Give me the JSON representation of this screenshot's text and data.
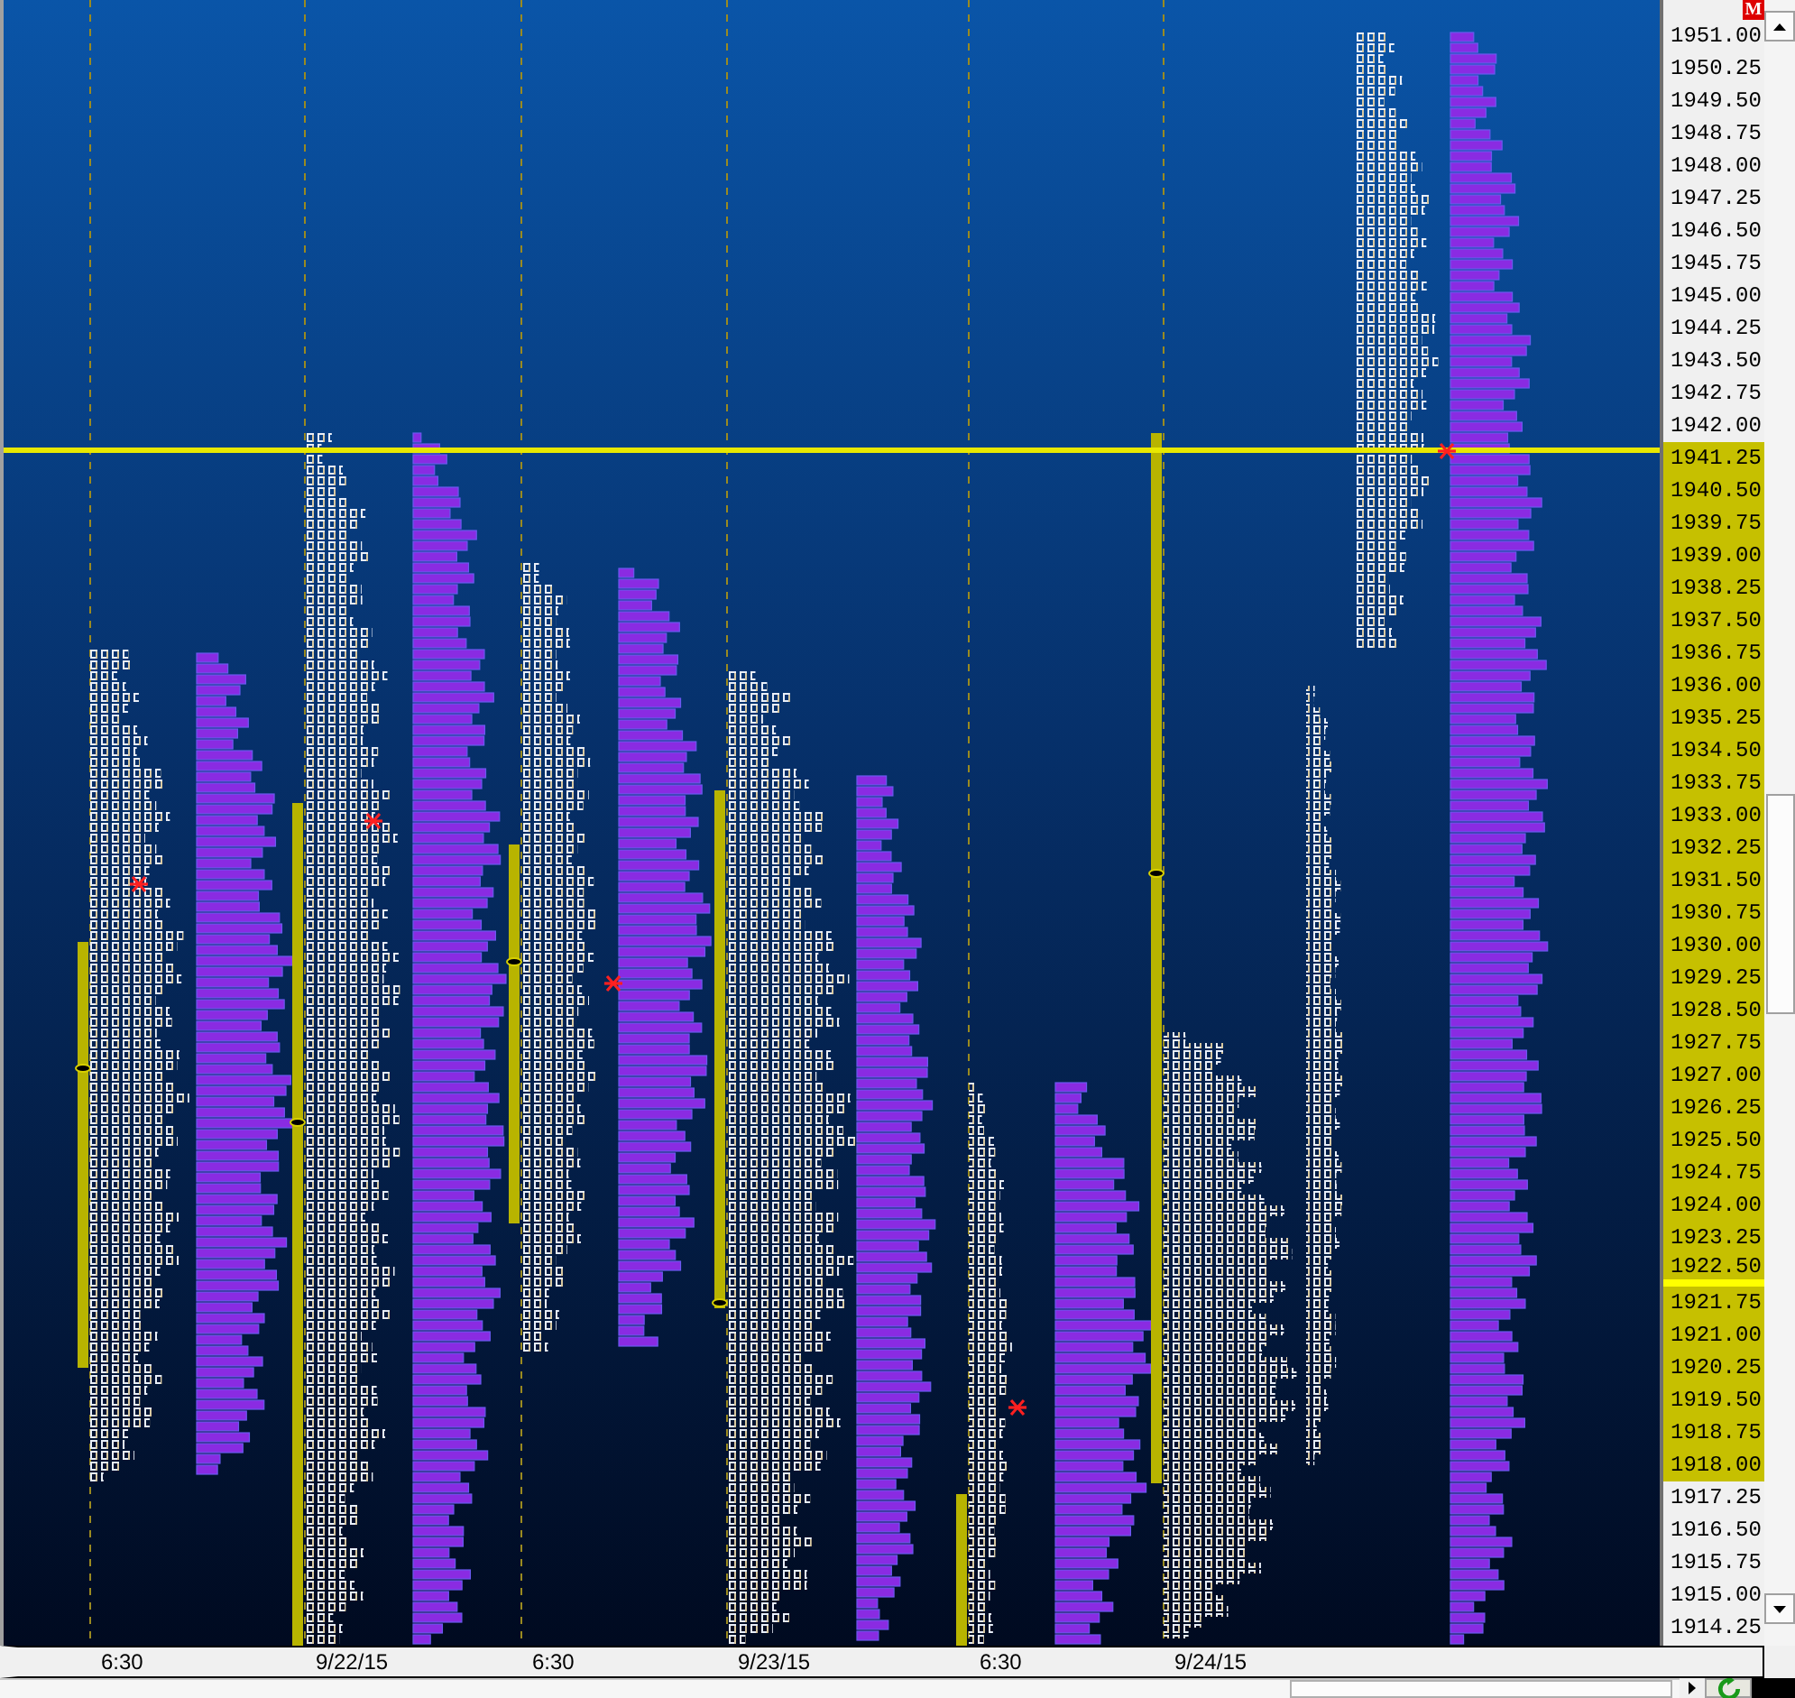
{
  "price_axis": {
    "badge": "M",
    "labels": [
      {
        "text": "1951.00",
        "highlighted": false,
        "marked": false
      },
      {
        "text": "1950.25",
        "highlighted": false,
        "marked": false
      },
      {
        "text": "1949.50",
        "highlighted": false,
        "marked": false
      },
      {
        "text": "1948.75",
        "highlighted": false,
        "marked": false
      },
      {
        "text": "1948.00",
        "highlighted": false,
        "marked": false
      },
      {
        "text": "1947.25",
        "highlighted": false,
        "marked": false
      },
      {
        "text": "1946.50",
        "highlighted": false,
        "marked": false
      },
      {
        "text": "1945.75",
        "highlighted": false,
        "marked": false
      },
      {
        "text": "1945.00",
        "highlighted": false,
        "marked": false
      },
      {
        "text": "1944.25",
        "highlighted": false,
        "marked": false
      },
      {
        "text": "1943.50",
        "highlighted": false,
        "marked": false
      },
      {
        "text": "1942.75",
        "highlighted": false,
        "marked": false
      },
      {
        "text": "1942.00",
        "highlighted": false,
        "marked": false
      },
      {
        "text": "1941.25",
        "highlighted": true,
        "marked": false
      },
      {
        "text": "1940.50",
        "highlighted": true,
        "marked": false
      },
      {
        "text": "1939.75",
        "highlighted": true,
        "marked": false
      },
      {
        "text": "1939.00",
        "highlighted": true,
        "marked": false
      },
      {
        "text": "1938.25",
        "highlighted": true,
        "marked": false
      },
      {
        "text": "1937.50",
        "highlighted": true,
        "marked": false
      },
      {
        "text": "1936.75",
        "highlighted": true,
        "marked": false
      },
      {
        "text": "1936.00",
        "highlighted": true,
        "marked": false
      },
      {
        "text": "1935.25",
        "highlighted": true,
        "marked": false
      },
      {
        "text": "1934.50",
        "highlighted": true,
        "marked": false
      },
      {
        "text": "1933.75",
        "highlighted": true,
        "marked": false
      },
      {
        "text": "1933.00",
        "highlighted": true,
        "marked": false
      },
      {
        "text": "1932.25",
        "highlighted": true,
        "marked": false
      },
      {
        "text": "1931.50",
        "highlighted": true,
        "marked": false
      },
      {
        "text": "1930.75",
        "highlighted": true,
        "marked": false
      },
      {
        "text": "1930.00",
        "highlighted": true,
        "marked": false
      },
      {
        "text": "1929.25",
        "highlighted": true,
        "marked": false
      },
      {
        "text": "1928.50",
        "highlighted": true,
        "marked": false
      },
      {
        "text": "1927.75",
        "highlighted": true,
        "marked": false
      },
      {
        "text": "1927.00",
        "highlighted": true,
        "marked": false
      },
      {
        "text": "1926.25",
        "highlighted": true,
        "marked": false
      },
      {
        "text": "1925.50",
        "highlighted": true,
        "marked": false
      },
      {
        "text": "1924.75",
        "highlighted": true,
        "marked": false
      },
      {
        "text": "1924.00",
        "highlighted": true,
        "marked": false
      },
      {
        "text": "1923.25",
        "highlighted": true,
        "marked": false
      },
      {
        "text": "1922.50",
        "highlighted": true,
        "marked": true
      },
      {
        "text": "1921.75",
        "highlighted": true,
        "marked": false
      },
      {
        "text": "1921.00",
        "highlighted": true,
        "marked": false
      },
      {
        "text": "1920.25",
        "highlighted": true,
        "marked": false
      },
      {
        "text": "1919.50",
        "highlighted": true,
        "marked": false
      },
      {
        "text": "1918.75",
        "highlighted": true,
        "marked": false
      },
      {
        "text": "1918.00",
        "highlighted": true,
        "marked": false
      },
      {
        "text": "1917.25",
        "highlighted": false,
        "marked": false
      },
      {
        "text": "1916.50",
        "highlighted": false,
        "marked": false
      },
      {
        "text": "1915.75",
        "highlighted": false,
        "marked": false
      },
      {
        "text": "1915.00",
        "highlighted": false,
        "marked": false
      },
      {
        "text": "1914.25",
        "highlighted": false,
        "marked": false
      }
    ]
  },
  "time_axis": {
    "labels": [
      "6:30",
      "9/22/15",
      "6:30",
      "9/23/15",
      "6:30",
      "9/24/15"
    ]
  }
}
